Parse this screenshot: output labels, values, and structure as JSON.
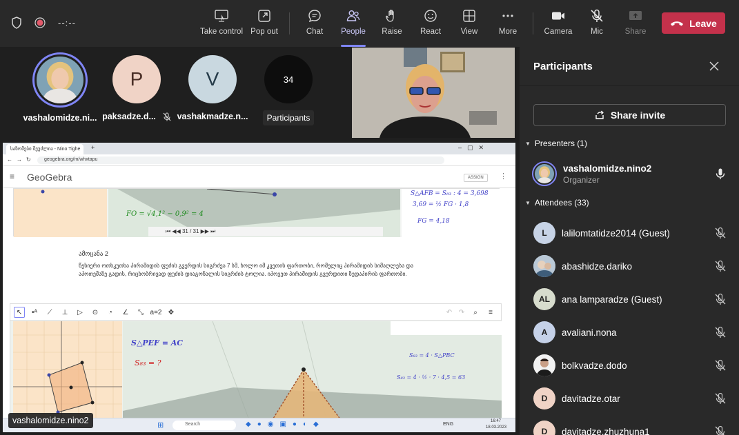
{
  "topbar": {
    "timer": "--:--",
    "buttons": {
      "take_control": "Take control",
      "pop_out": "Pop out",
      "chat": "Chat",
      "people": "People",
      "raise": "Raise",
      "react": "React",
      "view": "View",
      "more": "More",
      "camera": "Camera",
      "mic": "Mic",
      "share": "Share"
    },
    "leave_label": "Leave"
  },
  "stage": {
    "tiles": [
      {
        "name": "vashalomidze.ni...",
        "initial": ""
      },
      {
        "name": "paksadze.d...",
        "initial": "P"
      },
      {
        "name": "vashakmadze.n...",
        "initial": "V"
      },
      {
        "name": "",
        "initial": "34"
      }
    ],
    "participants_badge": "Participants",
    "presenter_label": "vashalomidze.nino2",
    "shared_screen": {
      "tab_title": "საზომები შეუძლია - Nino Tighe",
      "url": "geogebra.org/m/whxtapu",
      "logo": "GeoGebra",
      "assign": "ASSIGN",
      "applet1_formula": "FO = √4,1² − 0,9² = 4",
      "applet1_rhs": [
        "S△AFB = S₈₃ : 4 = 3,698",
        "3,69 = ½ FG · 1,8",
        "FG = 4,18"
      ],
      "applet1_nav": "31 / 31",
      "task_title": "ამოცანა 2",
      "task_text": "წესიერი ოთხკუთხა პირამიდის ფუძის გვერდის სიგრძეა 7 სმ, ხოლო იმ კვეთის ფართობი, რომელიც პირამიდის სიმაღლესა და აპოთემაზე გადის, რიცხობრივად ფუძის დიაგონალის სიგრძის ტოლია. იპოვეთ პირამიდის გვერდითი ზედაპირის ფართობი.",
      "applet2_formula1": "S△PEF = AC",
      "applet2_formula2": "S₈₃ = ?",
      "applet2_rhs1": "S₈₃ = 4 · S△PBC",
      "applet2_rhs2": "S₈₃ = 4 · ½ · 7 · 4,5 = 63",
      "taskbar_search": "Search",
      "taskbar_lang": "ENG",
      "taskbar_time": "16:47",
      "taskbar_date": "18.03.2023"
    }
  },
  "panel": {
    "title": "Participants",
    "share_invite": "Share invite",
    "presenters_header": "Presenters (1)",
    "presenters": [
      {
        "name": "vashalomidze.nino2",
        "role": "Organizer",
        "avatar_color": "#d9c9b0",
        "initials": ""
      }
    ],
    "attendees_header": "Attendees (33)",
    "attendees": [
      {
        "name": "lalilomtatidze2014 (Guest)",
        "initials": "L",
        "avatar_color": "#c7d3e6"
      },
      {
        "name": "abashidze.dariko",
        "initials": "",
        "avatar_color": "#9fb4c8"
      },
      {
        "name": "ana lamparadze (Guest)",
        "initials": "AL",
        "avatar_color": "#d7dccd"
      },
      {
        "name": "avaliani.nona",
        "initials": "A",
        "avatar_color": "#c5d1e8"
      },
      {
        "name": "bolkvadze.dodo",
        "initials": "",
        "avatar_color": "#6b6b6b"
      },
      {
        "name": "davitadze.otar",
        "initials": "D",
        "avatar_color": "#f0d3c6"
      },
      {
        "name": "davitadze.zhuzhuna1",
        "initials": "D",
        "avatar_color": "#f0d3c6"
      }
    ]
  },
  "colors": {
    "leave": "#c4314b",
    "accent": "#7f85f5",
    "topbar": "#292929",
    "panel": "#292929"
  }
}
